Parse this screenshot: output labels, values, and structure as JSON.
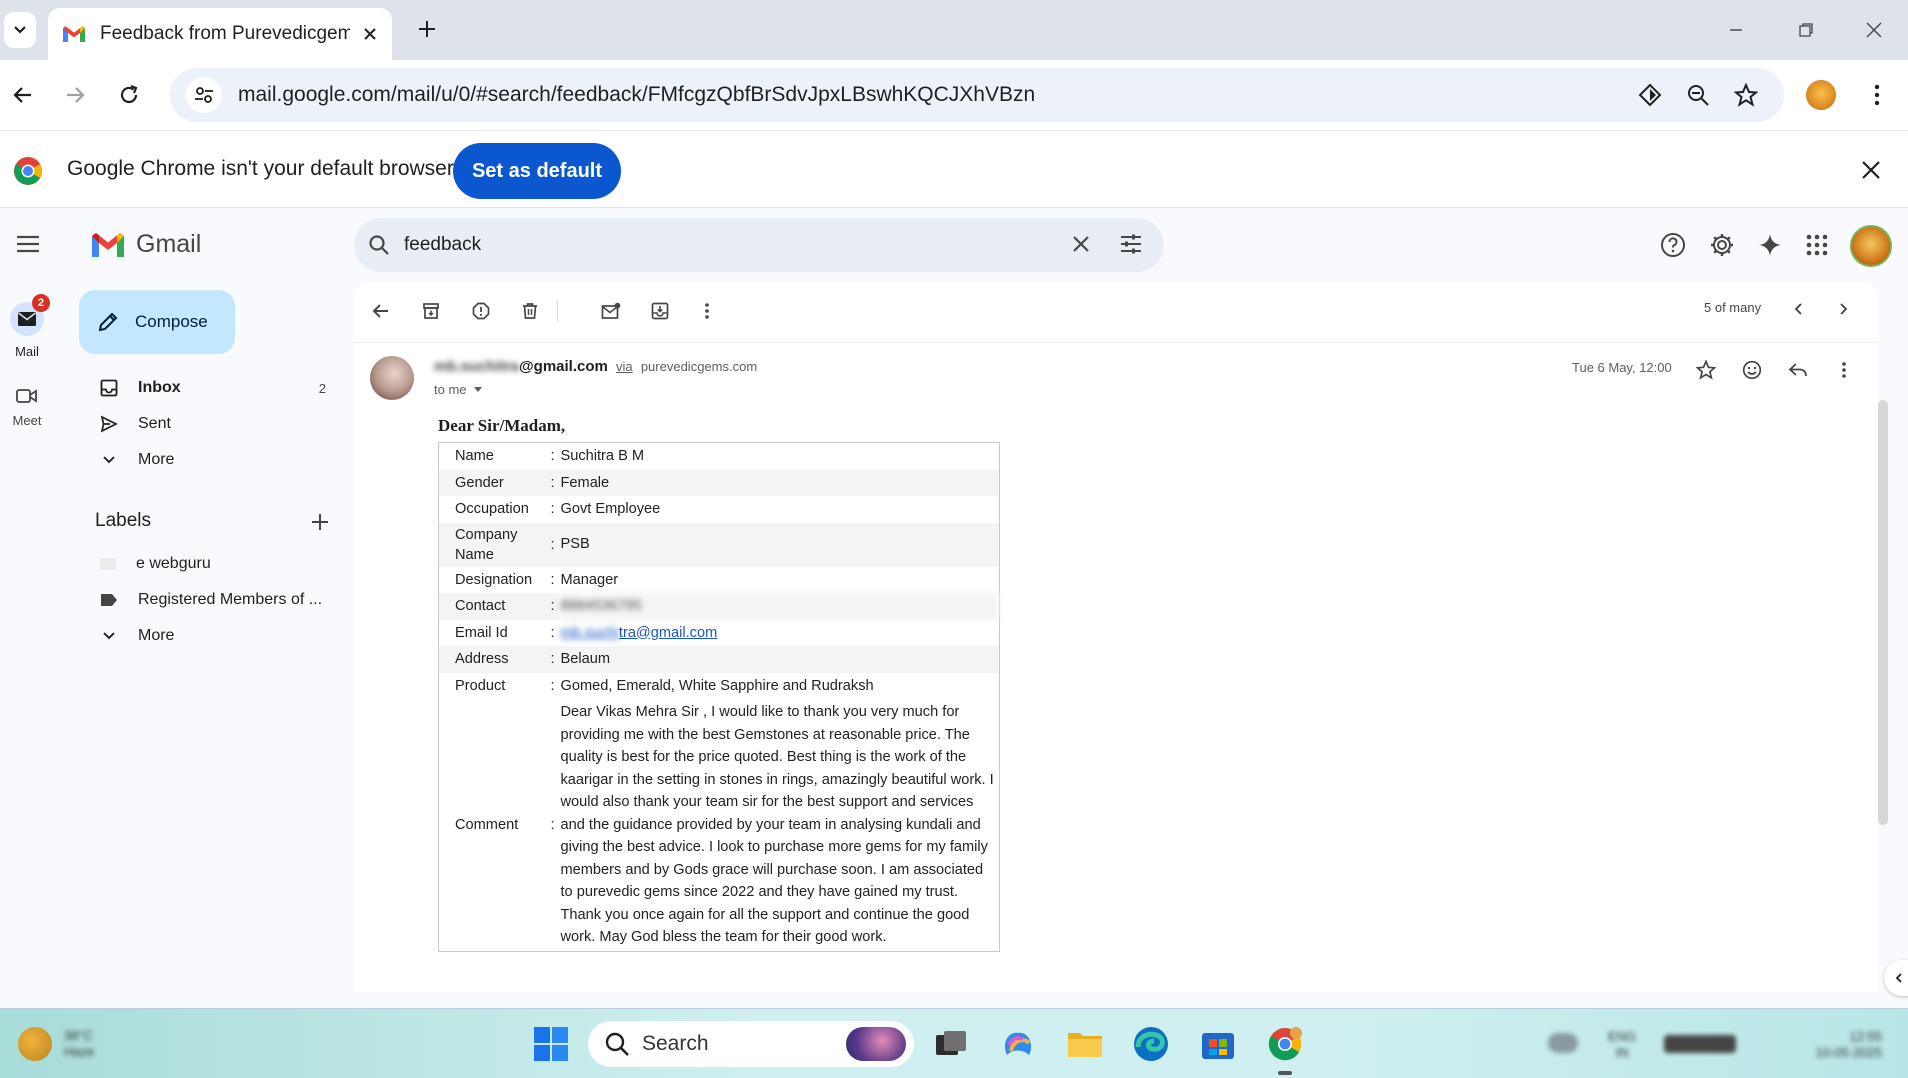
{
  "browser": {
    "tab_title": "Feedback from Purevedicgems",
    "url": "mail.google.com/mail/u/0/#search/feedback/FMfcgzQbfBrSdvJpxLBswhKQCJXhVBzn"
  },
  "infobar": {
    "message": "Google Chrome isn't your default browser",
    "button": "Set as default"
  },
  "gmail": {
    "logo_text": "Gmail",
    "search_value": "feedback",
    "rail": {
      "mail_label": "Mail",
      "mail_badge": "2",
      "meet_label": "Meet"
    },
    "compose": "Compose",
    "nav": {
      "inbox": "Inbox",
      "inbox_count": "2",
      "sent": "Sent",
      "more": "More"
    },
    "labels": {
      "title": "Labels",
      "items": [
        "e webguru",
        "Registered Members of ..."
      ],
      "more": "More"
    },
    "pager": "5 of many"
  },
  "message": {
    "sender_hidden": "mb.suchitra",
    "sender_domain": "@gmail.com",
    "via": "via",
    "via_domain": "purevedicgems.com",
    "to": "to me",
    "date": "Tue 6 May, 12:00",
    "salutation": "Dear Sir/Madam,",
    "fields": {
      "name_k": "Name",
      "name_v": "Suchitra B M",
      "gender_k": "Gender",
      "gender_v": "Female",
      "occupation_k": "Occupation",
      "occupation_v": "Govt Employee",
      "company_k": "Company Name",
      "company_v": "PSB",
      "designation_k": "Designation",
      "designation_v": "Manager",
      "contact_k": "Contact",
      "contact_v": "8884536795",
      "email_k": "Email Id",
      "email_hidden": "mb.suchi",
      "email_v": "tra@gmail.com",
      "address_k": "Address",
      "address_v": "Belaum",
      "product_k": "Product",
      "product_v": "Gomed, Emerald, White Sapphire and Rudraksh",
      "comment_k": "Comment",
      "comment_v": "Dear Vikas Mehra Sir , I would like to thank you very much for providing me with the best Gemstones at reasonable price. The quality is best for the price quoted. Best thing is the work of the kaarigar in the setting in stones in rings, amazingly beautiful work. I would also thank your team sir for the best support and services and the guidance provided by your team in analysing kundali and giving the best advice. I look to purchase more gems for my family members and by Gods grace will purchase soon. I am associated to purevedic gems since 2022 and they have gained my trust. Thank you once again for all the support and continue the good work. May God bless the team for their good work."
    },
    "colon": ":"
  },
  "taskbar": {
    "weather_temp": "38°C",
    "weather_desc": "Haze",
    "search": "Search",
    "lang_1": "ENG",
    "lang_2": "IN",
    "time": "12:55",
    "date": "10-05-2025"
  }
}
